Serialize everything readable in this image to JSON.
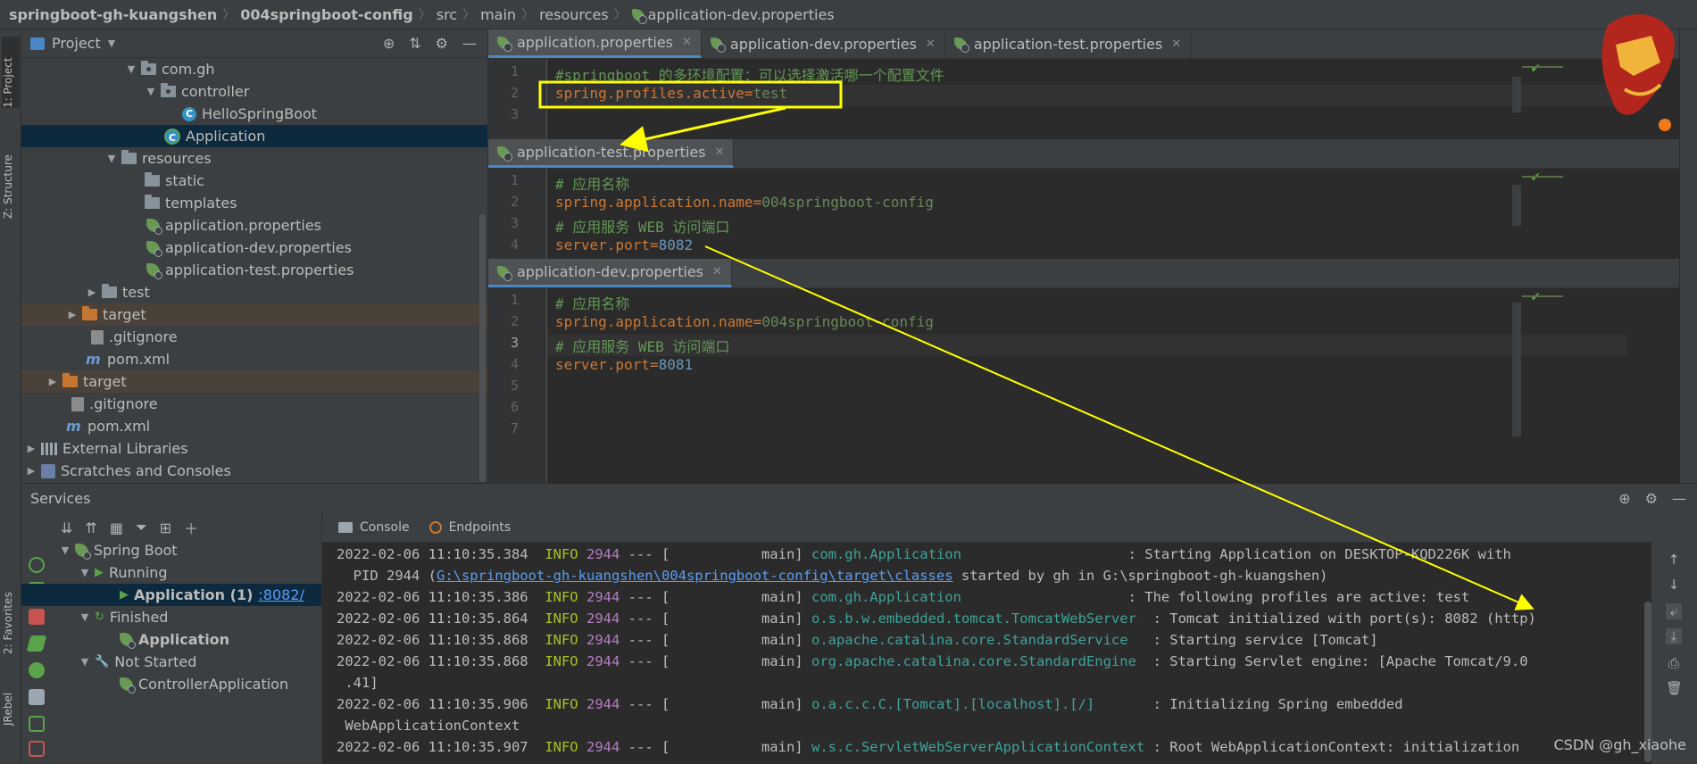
{
  "breadcrumb": {
    "project": "springboot-gh-kuangshen",
    "module": "004springboot-config",
    "src": "src",
    "main": "main",
    "resources": "resources",
    "file": "application-dev.properties"
  },
  "left_strip": {
    "project_tab": "1: Project",
    "structure_tab": "Z: Structure",
    "favorites_tab": "2: Favorites",
    "jrebel_tab": "JRebel"
  },
  "project_panel": {
    "title": "Project",
    "tree": [
      {
        "label": "com.gh"
      },
      {
        "label": "controller"
      },
      {
        "label": "HelloSpringBoot"
      },
      {
        "label": "Application"
      },
      {
        "label": "resources"
      },
      {
        "label": "static"
      },
      {
        "label": "templates"
      },
      {
        "label": "application.properties"
      },
      {
        "label": "application-dev.properties"
      },
      {
        "label": "application-test.properties"
      },
      {
        "label": "test"
      },
      {
        "label": "target"
      },
      {
        "label": ".gitignore"
      },
      {
        "label": "pom.xml"
      },
      {
        "label": "target"
      },
      {
        "label": ".gitignore"
      },
      {
        "label": "pom.xml"
      },
      {
        "label": "External Libraries"
      },
      {
        "label": "Scratches and Consoles"
      }
    ]
  },
  "editor_main": {
    "tabs": [
      {
        "label": "application.properties",
        "active": true
      },
      {
        "label": "application-dev.properties",
        "active": false
      },
      {
        "label": "application-test.properties",
        "active": false
      }
    ],
    "line_numbers": [
      "1",
      "2",
      "3"
    ],
    "line1_comment": "#springboot 的多环境配置：可以选择激活哪一个配置文件",
    "line2_key": "spring.profiles.active",
    "line2_eq": "=",
    "line2_val": "test"
  },
  "editor_test": {
    "tab": "application-test.properties",
    "line_numbers": [
      "1",
      "2",
      "3",
      "4"
    ],
    "l1": "# 应用名称",
    "l2_key": "spring.application.name",
    "l2_eq": "=",
    "l2_val": "004springboot-config",
    "l3": "# 应用服务 WEB 访问端口",
    "l4_key": "server.port",
    "l4_eq": "=",
    "l4_val": "8082"
  },
  "editor_dev": {
    "tab": "application-dev.properties",
    "line_numbers": [
      "1",
      "2",
      "3",
      "4",
      "5",
      "6",
      "7"
    ],
    "l1": "# 应用名称",
    "l2_key": "spring.application.name",
    "l2_eq": "=",
    "l2_val": "004springboot-config",
    "l3": "# 应用服务 WEB 访问端口",
    "l4_key": "server.port",
    "l4_eq": "=",
    "l4_val": "8081"
  },
  "services": {
    "title": "Services",
    "tree": {
      "spring_boot": "Spring Boot",
      "running": "Running",
      "running_app": "Application (1)",
      "running_port": ":8082/",
      "finished": "Finished",
      "finished_app": "Application",
      "not_started": "Not Started",
      "controller_app": "ControllerApplication"
    },
    "console_tabs": {
      "console": "Console",
      "endpoints": "Endpoints"
    }
  },
  "console": {
    "lines": [
      {
        "ts": "2022-02-06 11:10:35.384",
        "lvl": "INFO",
        "pid": "2944",
        "sep": "--- [",
        "thread": "           main]",
        "logger": "com.gh.Application",
        "msg": ": Starting Application on DESKTOP-KQD226K with"
      },
      {
        "cont_pre": "  PID 2944 (",
        "cont_link": "G:\\springboot-gh-kuangshen\\004springboot-config\\target\\classes",
        "cont_post": " started by gh in G:\\springboot-gh-kuangshen)"
      },
      {
        "ts": "2022-02-06 11:10:35.386",
        "lvl": "INFO",
        "pid": "2944",
        "sep": "--- [",
        "thread": "           main]",
        "logger": "com.gh.Application",
        "msg": ": The following profiles are active: test"
      },
      {
        "ts": "2022-02-06 11:10:35.864",
        "lvl": "INFO",
        "pid": "2944",
        "sep": "--- [",
        "thread": "           main]",
        "logger": "o.s.b.w.embedded.tomcat.TomcatWebServer",
        "msg": ": Tomcat initialized with port(s): 8082 (http)"
      },
      {
        "ts": "2022-02-06 11:10:35.868",
        "lvl": "INFO",
        "pid": "2944",
        "sep": "--- [",
        "thread": "           main]",
        "logger": "o.apache.catalina.core.StandardService",
        "msg": ": Starting service [Tomcat]"
      },
      {
        "ts": "2022-02-06 11:10:35.868",
        "lvl": "INFO",
        "pid": "2944",
        "sep": "--- [",
        "thread": "           main]",
        "logger": "org.apache.catalina.core.StandardEngine",
        "msg": ": Starting Servlet engine: [Apache Tomcat/9.0"
      },
      {
        "cont_plain": " .41]"
      },
      {
        "ts": "2022-02-06 11:10:35.906",
        "lvl": "INFO",
        "pid": "2944",
        "sep": "--- [",
        "thread": "           main]",
        "logger": "o.a.c.c.C.[Tomcat].[localhost].[/]",
        "msg": ": Initializing Spring embedded"
      },
      {
        "cont_plain": " WebApplicationContext"
      },
      {
        "ts": "2022-02-06 11:10:35.907",
        "lvl": "INFO",
        "pid": "2944",
        "sep": "--- [",
        "thread": "           main]",
        "logger": "w.s.c.ServletWebServerApplicationContext",
        "msg": ": Root WebApplicationContext: initialization"
      }
    ]
  },
  "watermark": "CSDN @gh_xiaohe",
  "colors": {
    "highlight_box": "#ffff00",
    "arrow": "#ffff00",
    "selection": "#0d293e",
    "keyword": "#cc7832",
    "comment": "#629755",
    "number": "#6897bb"
  },
  "icons": [
    "target-icon",
    "collapse-icon",
    "gear-icon",
    "minimize-icon",
    "spring-leaf-icon",
    "folder-icon",
    "class-icon"
  ]
}
